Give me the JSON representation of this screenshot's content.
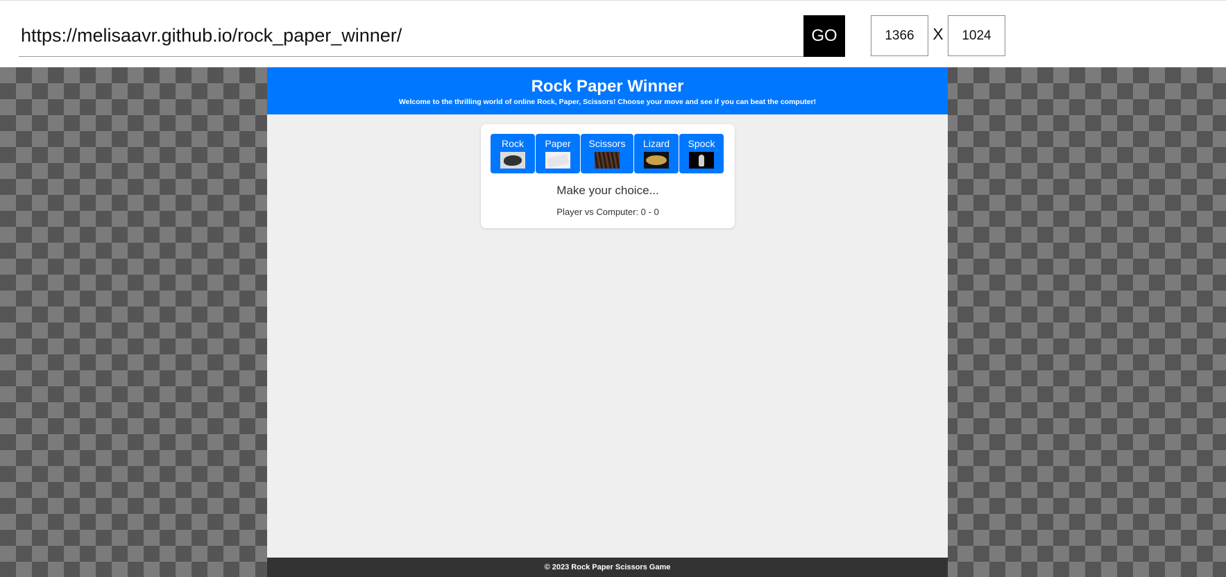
{
  "toolbar": {
    "url_value": "https://melisaavr.github.io/rock_paper_winner/",
    "go_label": "GO",
    "width_value": "1366",
    "separator": "X",
    "height_value": "1024"
  },
  "site": {
    "title": "Rock Paper Winner",
    "subtitle": "Welcome to the thrilling world of online Rock, Paper, Scissors! Choose your move and see if you can beat the computer!",
    "accent_color": "#0077ff",
    "choices": [
      {
        "label": "Rock",
        "icon": "rock-image"
      },
      {
        "label": "Paper",
        "icon": "paper-image"
      },
      {
        "label": "Scissors",
        "icon": "scissors-image"
      },
      {
        "label": "Lizard",
        "icon": "lizard-image"
      },
      {
        "label": "Spock",
        "icon": "spock-image"
      }
    ],
    "status_message": "Make your choice...",
    "score_text": "Player vs Computer: 0 - 0",
    "footer_text": "© 2023 Rock Paper Scissors Game"
  }
}
